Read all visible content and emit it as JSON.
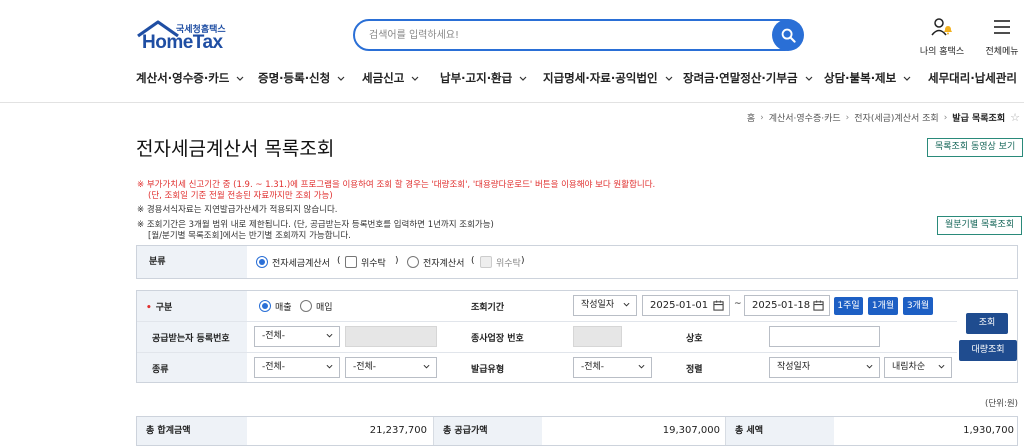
{
  "header": {
    "logo_sub": "국세청홈택스",
    "logo_main": "HomeTax",
    "search_placeholder": "검색어를 입력하세요!",
    "my_hometax": "나의 홈택스",
    "all_menu": "전체메뉴"
  },
  "gnb": [
    "계산서·영수증·카드",
    "증명·등록·신청",
    "세금신고",
    "납부·고지·환급",
    "지급명세·자료·공익법인",
    "장려금·연말정산·기부금",
    "상담·불복·제보",
    "세무대리·납세관리"
  ],
  "breadcrumb": [
    "홈",
    "계산서·영수증·카드",
    "전자(세금)계산서 조회",
    "발급 목록조회"
  ],
  "page": {
    "title": "전자세금계산서 목록조회",
    "video_button": "목록조회 동영상 보기",
    "halfyear_button": "월분기별 목록조회"
  },
  "notices": {
    "n1_line1": "※ 부가가치세 신고기간 중 (1.9. ~ 1.31.)에 프로그램을 이용하여 조회 할 경우는 '대량조회', '대용량다운로드' 버튼을 이용해야 보다 원활합니다.",
    "n1_line2": "(단, 조회일 기준 전월 전송된 자료까지만 조회 가능)",
    "n2": "※ 경용서식자료는 지연발급가산세가 적용되지 않습니다.",
    "n3_line1": "※ 조회기간은 3개월 범위 내로 제한됩니다. (단, 공급받는자 등록번호를 입력하면 1년까지 조회가능)",
    "n3_line2": "[월/분기별 목록조회]에서는 반기별 조회까지 가능합니다."
  },
  "classification": {
    "label": "분류",
    "opt1": "전자세금계산서",
    "opt1_sub": "위수탁",
    "opt2": "전자계산서",
    "opt2_sub": "위수탁",
    "paren_open": "(",
    "paren_close": ")"
  },
  "form": {
    "type_label": "구분",
    "type_opt1": "매출",
    "type_opt2": "매입",
    "period_label": "조회기간",
    "period_select": "작성일자",
    "date_from": "2025-01-01",
    "date_tilde": "~",
    "date_to": "2025-01-18",
    "btn_1w": "1주일",
    "btn_1m": "1개월",
    "btn_3m": "3개월",
    "buyer_label": "공급받는자 등록번호",
    "buyer_select": "-전체-",
    "biz_label": "종사업장 번호",
    "company_label": "상호",
    "kind_label": "종류",
    "kind_select1": "-전체-",
    "kind_select2": "-전체-",
    "issue_label": "발급유형",
    "issue_select": "-전체-",
    "sort_label": "정렬",
    "sort_select": "작성일자",
    "order_select": "내림차순",
    "search_button": "조회",
    "bulk_button": "대량조회"
  },
  "totals": {
    "unit": "(단위:원)",
    "total_label": "총 합계금액",
    "total_value": "21,237,700",
    "supply_label": "총 공급가액",
    "supply_value": "19,307,000",
    "tax_label": "총 세액",
    "tax_value": "1,930,700"
  }
}
